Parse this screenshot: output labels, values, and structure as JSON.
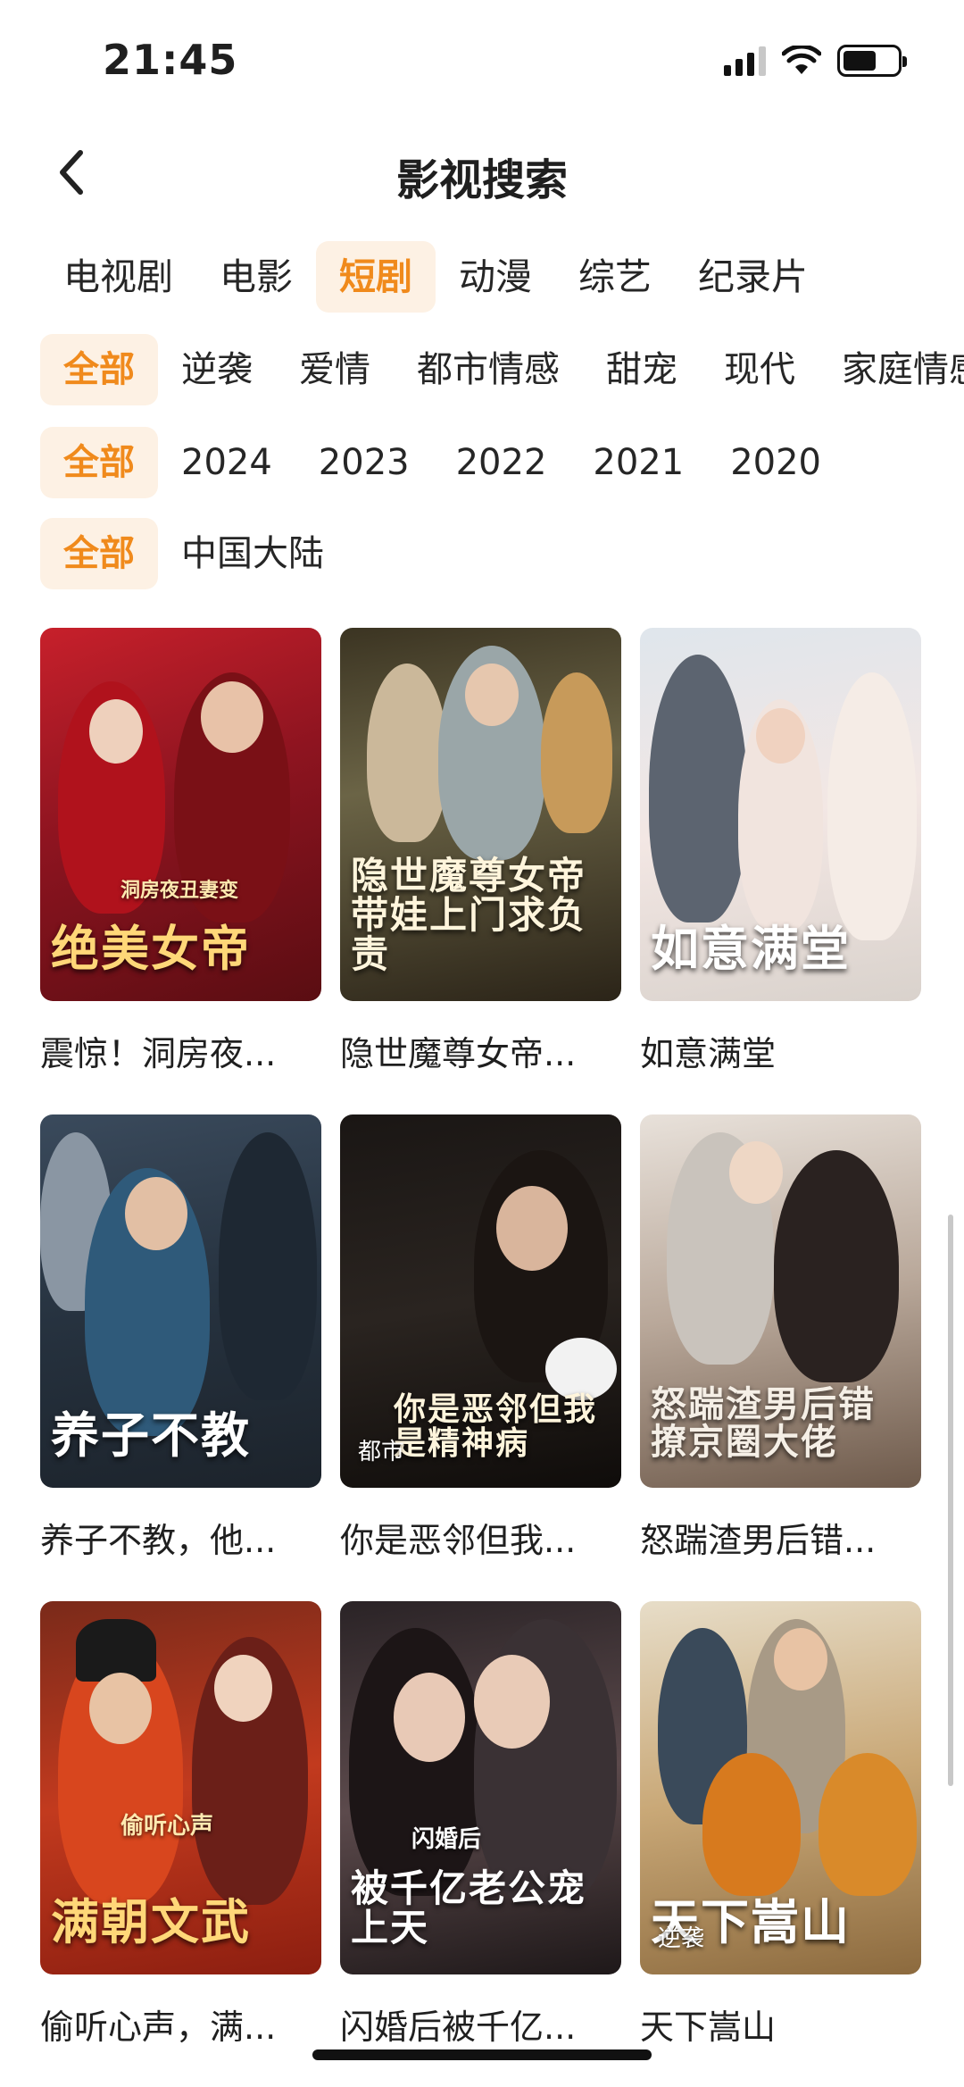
{
  "status": {
    "time": "21:45"
  },
  "nav": {
    "title": "影视搜索"
  },
  "filters": {
    "categories": [
      "电视剧",
      "电影",
      "短剧",
      "动漫",
      "综艺",
      "纪录片"
    ],
    "genres": [
      "全部",
      "逆袭",
      "爱情",
      "都市情感",
      "甜宠",
      "现代",
      "家庭情感"
    ],
    "years": [
      "全部",
      "2024",
      "2023",
      "2022",
      "2021",
      "2020"
    ],
    "regions": [
      "全部",
      "中国大陆"
    ],
    "selected": {
      "category": "短剧",
      "genre": "全部",
      "year": "全部",
      "region": "全部"
    }
  },
  "results": [
    {
      "title": "震惊！洞房夜...",
      "poster_title": "绝美女帝",
      "poster_subtitle": "洞房夜丑妻变",
      "tag": ""
    },
    {
      "title": "隐世魔尊女帝...",
      "poster_title": "隐世魔尊女帝带娃上门求负责",
      "poster_subtitle": "",
      "tag": ""
    },
    {
      "title": "如意满堂",
      "poster_title": "如意满堂",
      "poster_subtitle": "",
      "tag": ""
    },
    {
      "title": "养子不教，他...",
      "poster_title": "养子不教",
      "poster_subtitle": "",
      "tag": ""
    },
    {
      "title": "你是恶邻但我...",
      "poster_title": "你是恶邻但我是精神病",
      "poster_subtitle": "",
      "tag": "都市"
    },
    {
      "title": "怒踹渣男后错...",
      "poster_title": "怒踹渣男后错撩京圈大佬",
      "poster_subtitle": "",
      "tag": ""
    },
    {
      "title": "偷听心声，满...",
      "poster_title": "满朝文武",
      "poster_subtitle": "偷听心声",
      "tag": ""
    },
    {
      "title": "闪婚后被千亿...",
      "poster_title": "被千亿老公宠上天",
      "poster_subtitle": "闪婚后",
      "tag": ""
    },
    {
      "title": "天下嵩山",
      "poster_title": "天下嵩山",
      "poster_subtitle": "",
      "tag": "逆袭"
    }
  ]
}
